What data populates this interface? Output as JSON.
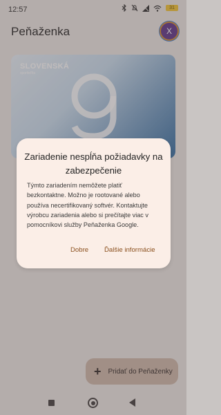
{
  "status_bar": {
    "time": "12:57",
    "battery": "31",
    "icons": [
      "bluetooth-icon",
      "mute-icon",
      "signal-icon",
      "wifi-icon",
      "battery-icon"
    ]
  },
  "app": {
    "title": "Peňaženka",
    "avatar_letter": "X"
  },
  "card": {
    "bank_name": "SLOVENSKÁ",
    "bank_subtitle": "sporiteľňa"
  },
  "dialog": {
    "title": "Zariadenie nespĺňa požiadavky na zabezpečenie",
    "body": "Týmto zariadením nemôžete platiť bezkontaktne. Možno je rootované alebo používa necertifikovaný softvér. Kontaktujte výrobcu zariadenia alebo si prečítajte viac v pomocníkovi služby Peňaženka Google.",
    "ok_label": "Dobre",
    "more_label": "Ďalšie informácie"
  },
  "fab": {
    "label": "Pridať do Peňaženky"
  },
  "colors": {
    "accent": "#8a4f1d",
    "dialog_bg": "#fbeee7",
    "fab_bg": "#cdb6a8"
  }
}
